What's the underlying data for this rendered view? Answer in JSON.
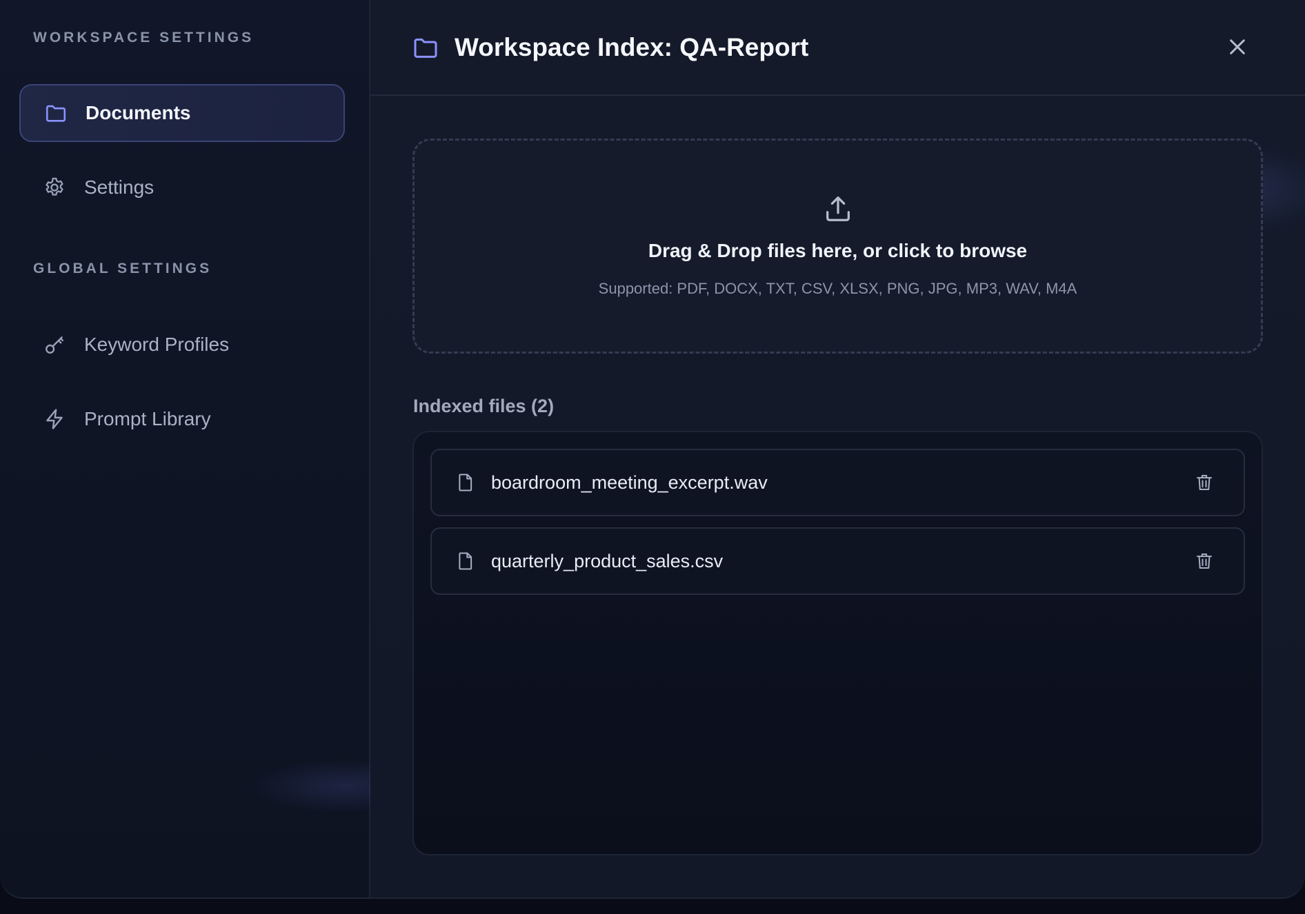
{
  "sidebar": {
    "workspace_section": "WORKSPACE SETTINGS",
    "global_section": "GLOBAL SETTINGS",
    "items": [
      {
        "label": "Documents",
        "icon": "folder-icon",
        "active": true
      },
      {
        "label": "Settings",
        "icon": "gear-icon",
        "active": false
      },
      {
        "label": "Keyword Profiles",
        "icon": "key-icon",
        "active": false
      },
      {
        "label": "Prompt Library",
        "icon": "lightning-icon",
        "active": false
      }
    ]
  },
  "header": {
    "title": "Workspace Index: QA-Report",
    "icon": "folder-icon",
    "close_icon": "close-icon"
  },
  "dropzone": {
    "icon": "upload-icon",
    "title": "Drag & Drop files here, or click to browse",
    "supported": "Supported: PDF, DOCX, TXT, CSV, XLSX, PNG, JPG, MP3, WAV, M4A"
  },
  "files": {
    "heading": "Indexed files (2)",
    "items": [
      {
        "name": "boardroom_meeting_excerpt.wav",
        "icon": "file-icon",
        "action_icon": "trash-icon"
      },
      {
        "name": "quarterly_product_sales.csv",
        "icon": "file-icon",
        "action_icon": "trash-icon"
      }
    ]
  },
  "colors": {
    "accent": "#8b93ff",
    "background": "#131827",
    "sidebar": "#0f1524"
  }
}
